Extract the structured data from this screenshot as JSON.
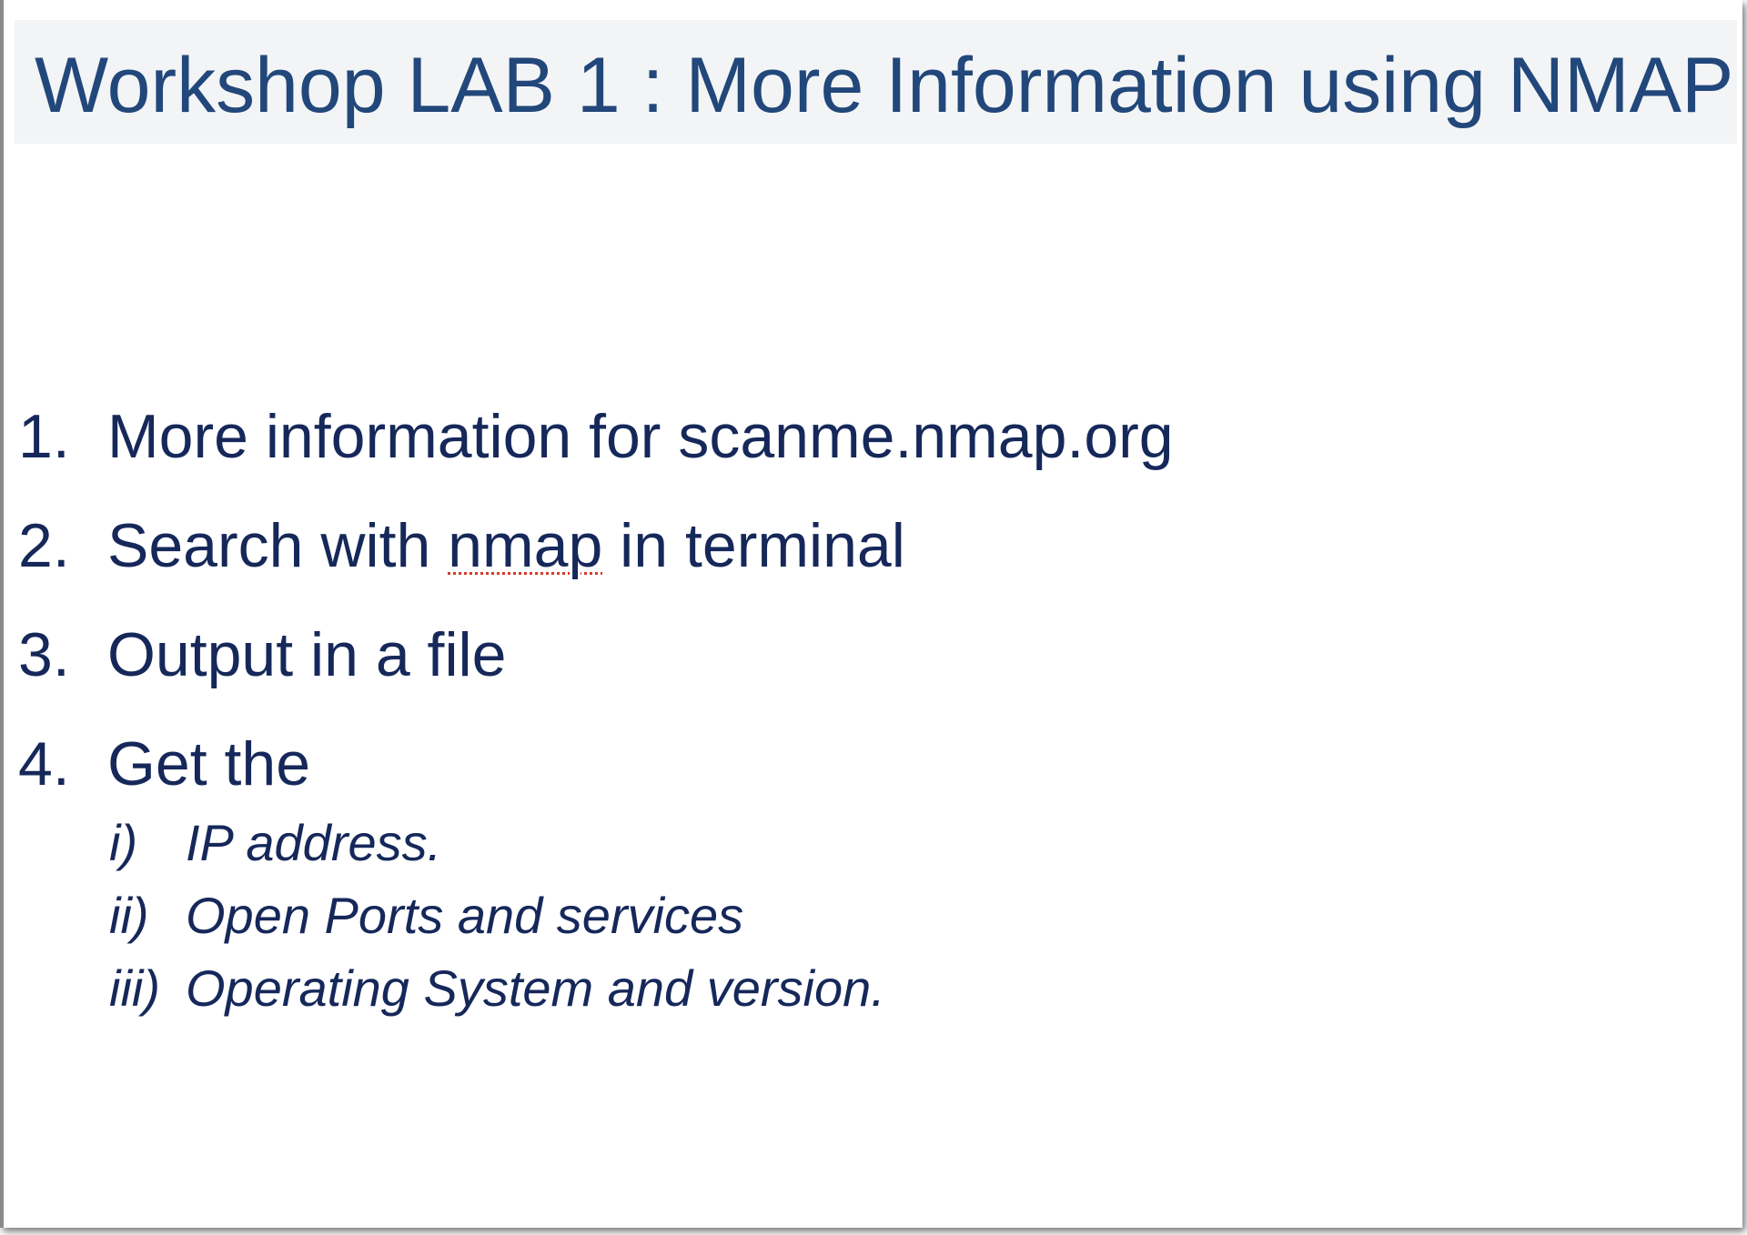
{
  "slide": {
    "title": "Workshop LAB 1 : More Information using NMAP",
    "items": [
      {
        "num": "1.",
        "text": "More information for scanme.nmap.org"
      },
      {
        "num": "2.",
        "pre": "Search with ",
        "flagged": "nmap",
        "post": " in terminal"
      },
      {
        "num": "3.",
        "text": "Output in a file"
      },
      {
        "num": "4.",
        "text": "Get the"
      }
    ],
    "subitems": [
      {
        "num": "i)",
        "text": "IP address."
      },
      {
        "num": "ii)",
        "text": "Open Ports and services"
      },
      {
        "num": "iii)",
        "text": "Operating System and version."
      }
    ]
  }
}
